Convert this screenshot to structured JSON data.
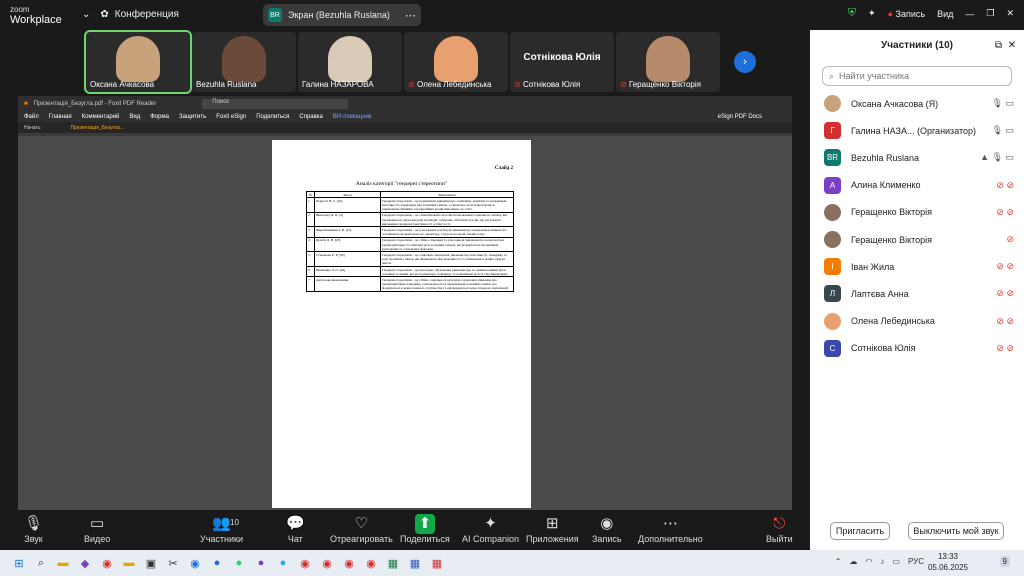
{
  "topbar": {
    "logo_top": "zoom",
    "logo_bottom": "Workplace",
    "meeting_title": "Конференция",
    "share_avatar": "BR",
    "share_label": "Экран (Bezuhla Ruslana)",
    "record_label": "Запись",
    "view_label": "Вид"
  },
  "strip": {
    "tiles": [
      {
        "name": "Оксана Ачкасова",
        "color": "#c7a27a"
      },
      {
        "name": "Bezuhla Ruslana",
        "color": "#6b4a3a"
      },
      {
        "name": "Галина НАЗАРОВА",
        "color": "#d9cbb8"
      },
      {
        "name": "Олена Лебединська",
        "color": "#e8a070"
      },
      {
        "name": "Сотнікова Юлія",
        "color": "#2b2b2b"
      },
      {
        "name": "Геращенко Вікторія",
        "color": "#b58a6a"
      }
    ],
    "big_name": "Сотнікова Юлія"
  },
  "pdf": {
    "window_title": "Презентація_Безугла.pdf - Foxit PDF Reader",
    "search": "Поиск",
    "menu": [
      "Файл",
      "Главная",
      "Комментарий",
      "Вид",
      "Форма",
      "Защитить",
      "Foxit eSign",
      "Поделиться",
      "Справка",
      "ВИ-помощник"
    ],
    "esign": "eSign PDF Docs",
    "tabs": [
      "Начать",
      "Презентація_Безугла..."
    ],
    "slide_label": "Слайд 2",
    "doc_title": "Аналіз категорії \"гендерні стереотипи\"",
    "headers": [
      "№",
      "Автор",
      "Визначення"
    ],
    "rows": [
      [
        "1",
        "Чернецт В. С. [45]",
        "Гендерні стереотипи – це нормативні уявлення про соматичні, психічні та поведінкові властивості, характерні для чоловіків і жінок, а також про поле їхньої праці за закріпленні сімейних і професійних ролей відповідно до статі."
      ],
      [
        "2",
        "Виноград О. О. [2]",
        "Гендерні стереотипи – це схематизовані способи встановлення соціального зв'язку, які проявляються через ритуали взаємодії, заборони, обов'язки та ігри, що регулюють вираження гендерної ідентичності особистості."
      ],
      [
        "3",
        "Жеребятникова І. В. [15]",
        "Гендерні стереотипи – це узагальнені в культурі уявлення про превалюючі жінкам або чоловікам ролі ментальності, характеру, статусно-рольові ознаки тощо."
      ],
      [
        "4",
        "Кулеба Д. В. [23]",
        "Гендерні стереотипи – це стійкі, спрощені та узагальнені уявлення про психологічні характеристики та соціальні ролі чоловіків і жінок, які формуються під впливом культурних та соціальних факторів."
      ],
      [
        "5",
        "Степанова Е. Р. [39]",
        "Гендерні стереотипи – це соціально закріплені уявлення про властивості, поведінку та ролі чоловіків і жінок, які визначають їхні можливості та обмеження в різних сферах життя."
      ],
      [
        "6",
        "Шевченко Л. О. [44]",
        "Гендерні стереотипи – це культурно обумовлені уявлення про те, якими повинні бути чоловіки та жінки, які ролі характеру, поведінку та поведінкові ролі їх слід виконувати."
      ],
      [
        "7",
        "Авторське визначення",
        "Гендерні стереотипи – це стійкі, соціально й культурно зумовлені уявлення про характеристики, поведінку, соціальні ролі та призначення чоловіків і жінок, що формуються в межах певного суспільства та відтворюються через процеси соціалізації."
      ]
    ]
  },
  "sidebar": {
    "title": "Участники (10)",
    "search_placeholder": "Найти участника",
    "participants": [
      {
        "name": "Оксана Ачкасова (Я)",
        "initial": "",
        "color": "#c7a27a",
        "photo": true,
        "icons": "🎙 ▭",
        "muted": false
      },
      {
        "name": "Галина НАЗА... (Организатор)",
        "initial": "Г",
        "color": "#d32f2f",
        "photo": false,
        "icons": "🎙 ▭",
        "muted": false
      },
      {
        "name": "Bezuhla Ruslana",
        "initial": "BR",
        "color": "#0e7a6c",
        "photo": false,
        "icons": "▲ 🎙 ▭",
        "muted": false
      },
      {
        "name": "Алина Клименко",
        "initial": "А",
        "color": "#7b3fc4",
        "photo": false,
        "icons": "⊘ ⊘",
        "muted": true
      },
      {
        "name": "Геращенко Вікторія",
        "initial": "",
        "color": "#8a7060",
        "photo": true,
        "icons": "⊘ ⊘",
        "muted": true
      },
      {
        "name": "Геращенко Вікторія",
        "initial": "",
        "color": "#8a7060",
        "photo": true,
        "icons": "⊘",
        "muted": true
      },
      {
        "name": "Іван Жила",
        "initial": "І",
        "color": "#f57c00",
        "photo": false,
        "icons": "⊘ ⊘",
        "muted": true
      },
      {
        "name": "Лаптєва Анна",
        "initial": "Л",
        "color": "#37474f",
        "photo": false,
        "icons": "⊘ ⊘",
        "muted": true
      },
      {
        "name": "Олена Лебединська",
        "initial": "",
        "color": "#e8a070",
        "photo": true,
        "icons": "⊘ ⊘",
        "muted": true
      },
      {
        "name": "Сотнікова Юлія",
        "initial": "С",
        "color": "#3949ab",
        "photo": false,
        "icons": "⊘ ⊘",
        "muted": true
      }
    ],
    "invite": "Пригласить",
    "unmute_me": "Выключить мой звук"
  },
  "controls": [
    {
      "label": "Звук",
      "icon": "🎙"
    },
    {
      "label": "Видео",
      "icon": "▭"
    },
    {
      "label": "Участники",
      "icon": "👥",
      "badge": "10"
    },
    {
      "label": "Чат",
      "icon": "💬"
    },
    {
      "label": "Отреагировать",
      "icon": "♡"
    },
    {
      "label": "Поделиться",
      "icon": "⬆"
    },
    {
      "label": "AI Companion",
      "icon": "✦"
    },
    {
      "label": "Приложения",
      "icon": "⊞"
    },
    {
      "label": "Запись",
      "icon": "◉"
    },
    {
      "label": "Дополнительно",
      "icon": "⋯"
    },
    {
      "label": "Выйти",
      "icon": "⎋"
    }
  ],
  "taskbar": {
    "time": "13:33",
    "date": "05.06.2025",
    "lang": "РУС",
    "notif": "9"
  }
}
